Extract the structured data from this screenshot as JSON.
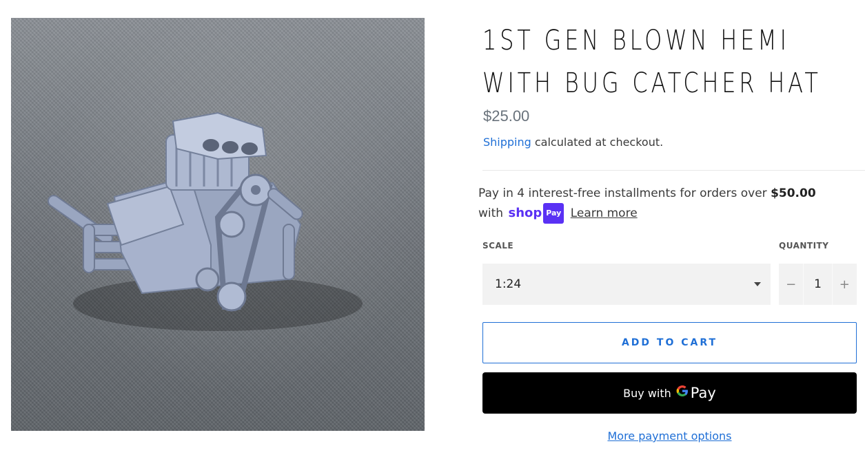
{
  "product": {
    "image_alt": "3D printed blown hemi engine model on grey fabric",
    "title_line1": "1ST GEN BLOWN HEMI",
    "title_line2": "WITH BUG CATCHER HAT",
    "price": "$25.00",
    "shipping_link": "Shipping",
    "shipping_suffix": " calculated at checkout."
  },
  "installments": {
    "text_prefix": "Pay in 4 interest-free installments for orders over ",
    "threshold": "$50.00",
    "with": "with",
    "shoppay_brand": "shop",
    "shoppay_badge": "Pay",
    "learn_more": "Learn more",
    "brand_color": "#5a31f4"
  },
  "options": {
    "scale_label": "SCALE",
    "scale_value": "1:24",
    "quantity_label": "QUANTITY",
    "quantity_value": "1",
    "minus_symbol": "−",
    "plus_symbol": "+"
  },
  "actions": {
    "add_to_cart": "ADD TO CART",
    "gpay_prefix": "Buy with",
    "gpay_g": "G",
    "gpay_pay": "Pay",
    "more_payment_options": "More payment options",
    "accent_color": "#1f6fd6"
  }
}
